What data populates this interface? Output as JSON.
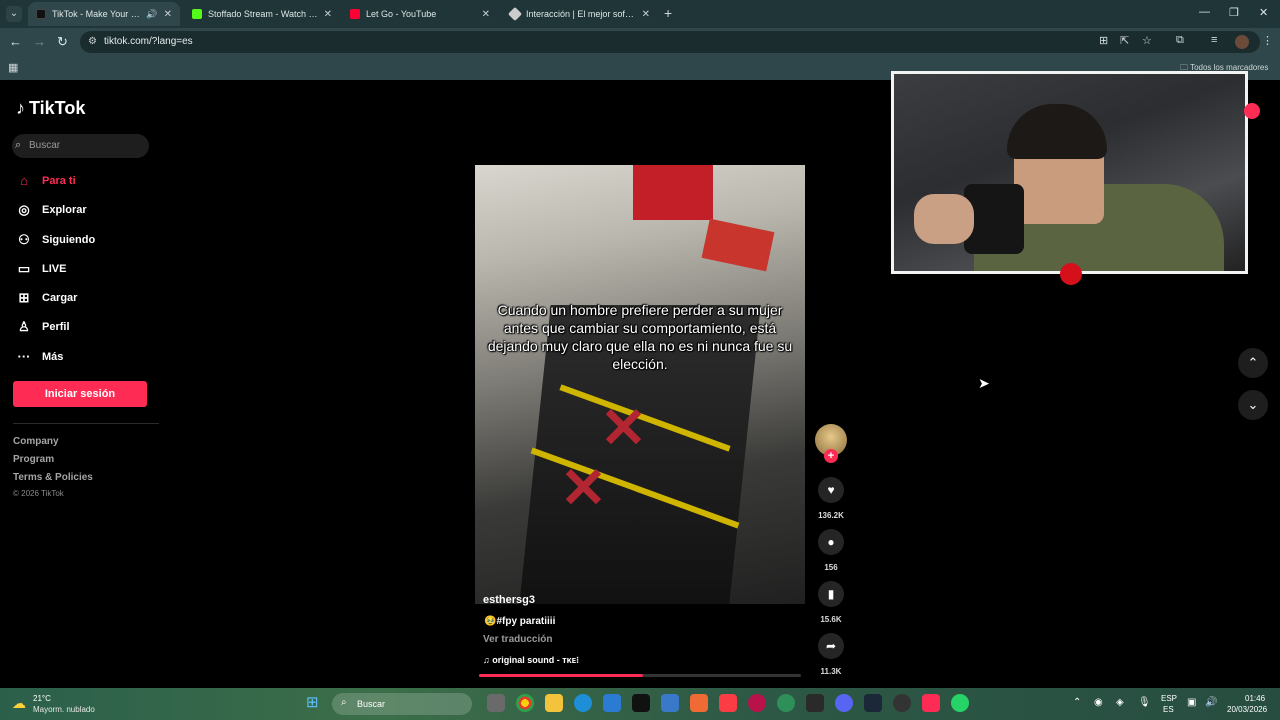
{
  "browser": {
    "tabs": [
      {
        "title": "TikTok - Make Your Day",
        "favicon_color": "#111111",
        "active": true
      },
      {
        "title": "Stoffado Stream - Watch Live o",
        "favicon_color": "#53fc18",
        "active": false
      },
      {
        "title": "Let Go - YouTube",
        "favicon_color": "#ff0033",
        "active": false
      },
      {
        "title": "Interacción | El mejor software p",
        "favicon_color": "#cccccc",
        "active": false
      }
    ],
    "new_tab": "+",
    "url": "tiktok.com/?lang=es",
    "bookmarks_all": "Todos los marcadores"
  },
  "tiktok": {
    "brand": "TikTok",
    "search_placeholder": "Buscar",
    "nav": [
      {
        "label": "Para ti",
        "icon": "home-icon",
        "active": true
      },
      {
        "label": "Explorar",
        "icon": "compass-icon",
        "active": false
      },
      {
        "label": "Siguiendo",
        "icon": "following-icon",
        "active": false
      },
      {
        "label": "LIVE",
        "icon": "live-icon",
        "active": false
      },
      {
        "label": "Cargar",
        "icon": "upload-icon",
        "active": false
      },
      {
        "label": "Perfil",
        "icon": "profile-icon",
        "active": false
      },
      {
        "label": "Más",
        "icon": "more-icon",
        "active": false
      }
    ],
    "login_label": "Iniciar sesión",
    "footer": [
      "Company",
      "Program",
      "Terms & Policies"
    ],
    "copyright": "© 2026 TikTok",
    "accent": "#fe2c55"
  },
  "video": {
    "caption": "Cuando un hombre prefiere perder a su mujer antes que cambiar su comportamiento, está dejando muy claro que ella no es ni nunca fue su elección.",
    "author": "esthersg3",
    "tags": "🥹#fpy paratiiii",
    "see_translation": "Ver traducción",
    "sound": "♫  original sound - ᴛᴋᴇ⁝",
    "progress_fraction": 0.51,
    "likes": "136.2K",
    "comments": "156",
    "saves": "15.6K",
    "shares": "11.3K"
  },
  "taskbar": {
    "temperature": "21°C",
    "weather": "Mayorm. nublado",
    "search_placeholder": "Buscar",
    "lang_top": "ESP",
    "lang_bottom": "ES",
    "time": "01:46",
    "date": "20/03/2026"
  }
}
